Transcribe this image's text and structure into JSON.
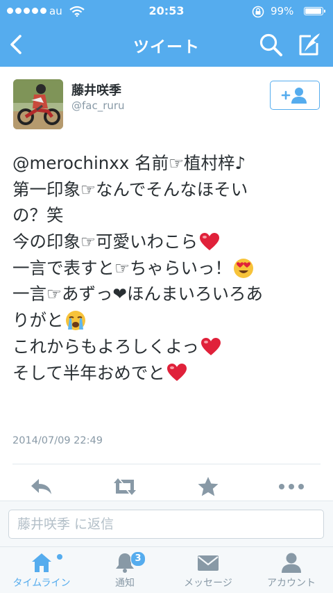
{
  "status_bar": {
    "carrier": "au",
    "time": "20:53",
    "battery_percent": "99%",
    "battery_level": 0.99
  },
  "nav": {
    "title": "ツイート",
    "icons": [
      "back-arrow-icon",
      "search-icon",
      "compose-tweet-icon"
    ]
  },
  "tweet": {
    "author_name": "藤井咲季",
    "author_handle": "@fac_ruru",
    "lines": [
      "@merochinxx 名前☞植村梓♪",
      "第一印象☞なんでそんなほそい",
      "の？笑",
      "今の印象☞可愛いわこら",
      "一言で表すと☞ちゃらいっ！",
      "一言☞あずっ❤ほんまいろいろあ",
      "りがと",
      "これからもよろしくよっ",
      "そして半年おめでと"
    ],
    "emoji_after_lines": {
      "3": "red-heart-emoji",
      "4": "heart-eyes-emoji",
      "6": "crying-face-emoji",
      "7": "red-heart-emoji",
      "8": "red-heart-emoji"
    },
    "timestamp": "2014/07/09 22:49",
    "actions": [
      "reply-icon",
      "retweet-icon",
      "favorite-star-icon",
      "more-dots-icon"
    ]
  },
  "reply": {
    "placeholder": "藤井咲季 に返信"
  },
  "tabbar": {
    "tabs": [
      {
        "label": "タイムライン",
        "icon": "home-icon",
        "active": true
      },
      {
        "label": "通知",
        "icon": "bell-icon",
        "badge": "3"
      },
      {
        "label": "メッセージ",
        "icon": "envelope-icon"
      },
      {
        "label": "アカウント",
        "icon": "person-icon"
      }
    ]
  },
  "colors": {
    "brand": "#55acee",
    "text": "#292f33",
    "secondary": "#8899a6",
    "heart": "#e0213a"
  }
}
